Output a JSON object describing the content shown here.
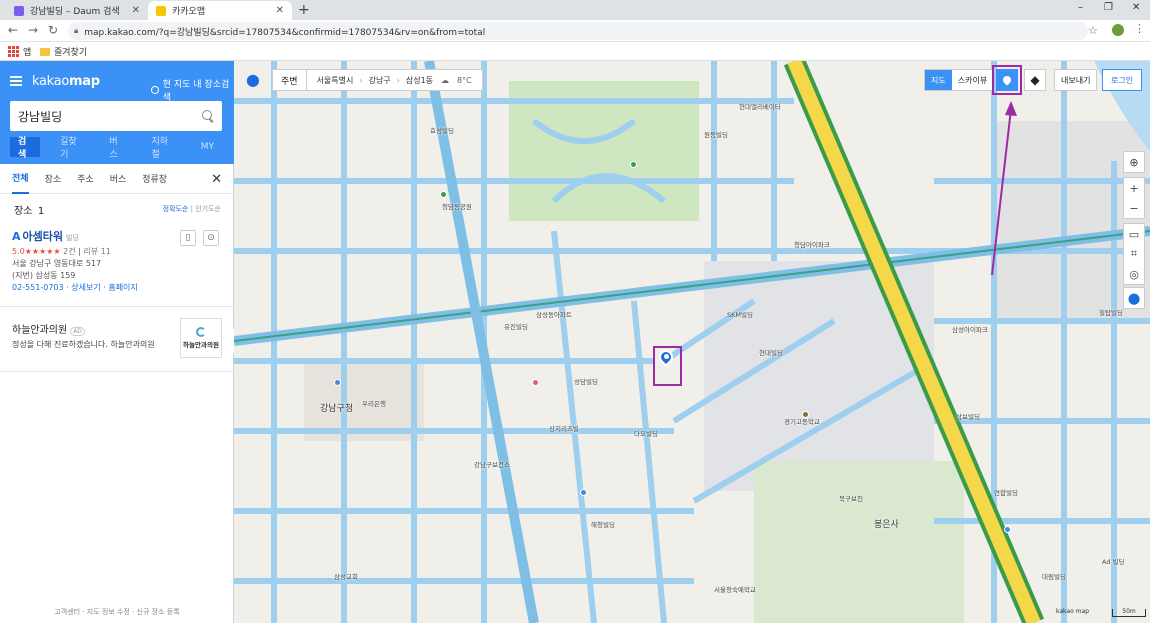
{
  "browser": {
    "tabs": [
      {
        "title": "강남빌딩 – Daum 검색",
        "favicon_color": "#7a5cf0"
      },
      {
        "title": "카카오맵",
        "favicon_color": "#f7c600"
      }
    ],
    "new_tab": "+",
    "window_controls": {
      "minimize": "–",
      "maximize": "❐",
      "close": "✕"
    },
    "nav": {
      "back": "←",
      "forward": "→",
      "reload": "↻"
    },
    "url": "map.kakao.com/?q=강남빌딩&srcid=17807534&confirmid=17807534&rv=on&from=total",
    "bookmarks": {
      "apps": "앱",
      "favorites": "즐겨찾기"
    }
  },
  "panel": {
    "logo_a": "kakao",
    "logo_b": "map",
    "nearby_search": "현 지도 내 장소검색",
    "search_value": "강남빌딩",
    "tabs": [
      "검색",
      "길찾기",
      "버스",
      "지하철",
      "MY"
    ],
    "filters": [
      "전체",
      "장소",
      "주소",
      "버스",
      "정류장"
    ],
    "place_label": "장소",
    "place_count": "1",
    "sort_accuracy": "정확도순",
    "sort_popular": "인기도순",
    "result": {
      "marker": "A",
      "name": "아셈타워",
      "category": "빌딩",
      "rating": "5.0★★★★★",
      "rating_count": "2건",
      "review": "리뷰 11",
      "address": "서울 강남구 영동대로 517",
      "jibun": "(지번) 삼성동 159",
      "phone": "02-551-0703",
      "detail": "상세보기",
      "homepage": "홈페이지"
    },
    "ad": {
      "name": "하늘안과의원",
      "tag": "AD",
      "desc": "정성을 다해 진료하겠습니다. 하늘안과의원",
      "logo_text": "하늘안과의원"
    },
    "footer": "고객센터 · 지도 정보 수정 · 신규 장소 등록"
  },
  "map": {
    "around": "주변",
    "breadcrumb": [
      "서울특별시",
      "강남구",
      "삼성1동"
    ],
    "weather": "8°C",
    "toggle": [
      "지도",
      "스카이뷰"
    ],
    "export": "내보내기",
    "login": "로그인",
    "brand": "kakao",
    "brand_sub": "map",
    "scale": "50m",
    "colors": {
      "road": "#9ecfee",
      "arterial": "#f5d84a",
      "highlight": "#9c2aa5",
      "accent": "#3b91f6"
    },
    "labels": [
      "강남구청",
      "삼성스포피아",
      "현대엘리베이터",
      "SKM빌딩",
      "삼성동아파트",
      "청담동공원",
      "경기고등학교",
      "봉은사",
      "북구보천",
      "삼성아이파크",
      "청담아이파크",
      "성담빌딩",
      "우리은행",
      "효성빌딩",
      "상지리츠빌",
      "유진빌딩",
      "삼성교회",
      "해청빌딩",
      "다모빌딩",
      "강남구보건소",
      "Ad 빌딩",
      "서울청숙예학교",
      "원등빌딩",
      "현대빌딩",
      "삼보빌딩",
      "연합빌딩",
      "대림빌딩",
      "힐탑빌딩"
    ]
  }
}
